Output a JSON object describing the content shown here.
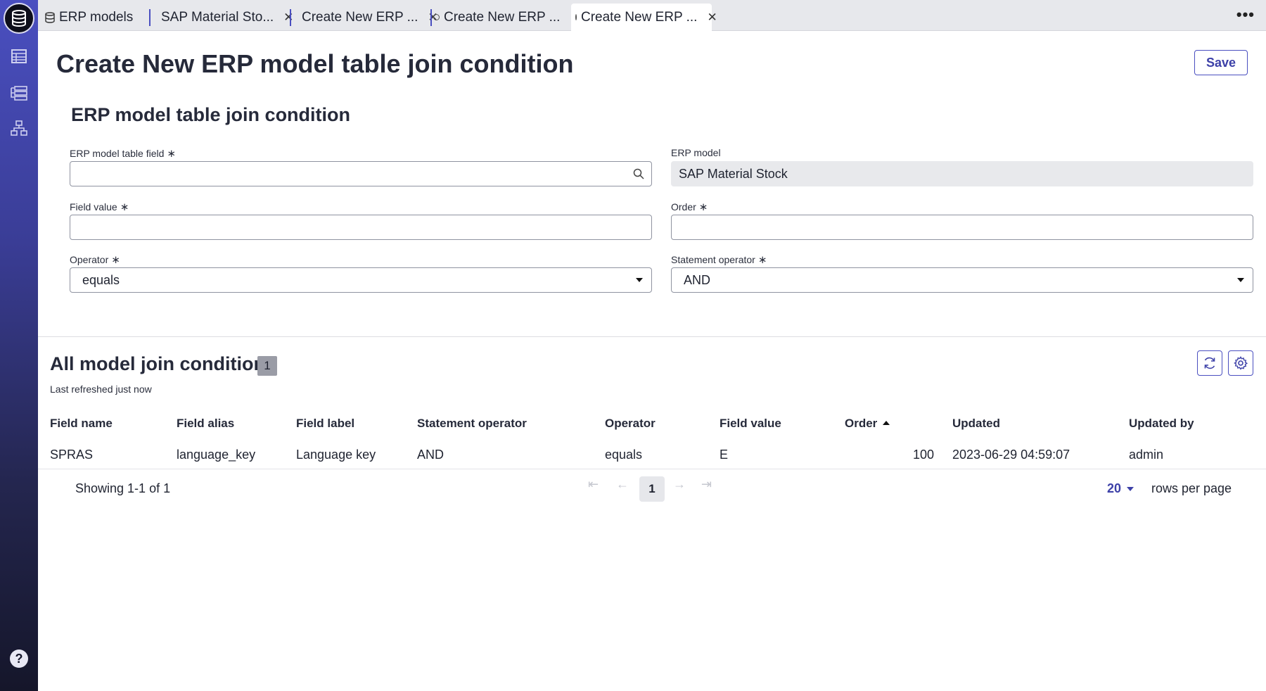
{
  "tabs": [
    {
      "label": "ERP models",
      "closable": false
    },
    {
      "label": "SAP Material Sto...",
      "closable": true
    },
    {
      "label": "Create New ERP ...",
      "closable": true
    },
    {
      "label": "Create New ERP ...",
      "closable": true
    },
    {
      "label": "Create New ERP ...",
      "closable": true,
      "active": true
    }
  ],
  "more_label": "•••",
  "page": {
    "title": "Create New ERP model table join condition",
    "save_label": "Save"
  },
  "form": {
    "section_title": "ERP model table join condition",
    "required_mark": "∗",
    "table_field": {
      "label": "ERP model table field",
      "value": ""
    },
    "erp_model": {
      "label": "ERP model",
      "value": "SAP Material Stock"
    },
    "field_value": {
      "label": "Field value",
      "value": ""
    },
    "order": {
      "label": "Order",
      "value": ""
    },
    "operator": {
      "label": "Operator",
      "value": "equals"
    },
    "statement_operator": {
      "label": "Statement operator",
      "value": "AND"
    }
  },
  "list": {
    "title": "All model join conditions",
    "count": "1",
    "refreshed": "Last refreshed just now",
    "columns": [
      "Field name",
      "Field alias",
      "Field label",
      "Statement operator",
      "Operator",
      "Field value",
      "Order",
      "Updated",
      "Updated by"
    ],
    "rows": [
      [
        "SPRAS",
        "language_key",
        "Language key",
        "AND",
        "equals",
        "E",
        "100",
        "2023-06-29 04:59:07",
        "admin"
      ]
    ],
    "showing": "Showing 1-1 of 1",
    "current_page": "1",
    "rows_per_page_value": "20",
    "rows_per_page_label": "rows per page"
  },
  "help_label": "?",
  "colors": {
    "accent": "#4a4fc0",
    "sidebar_dark": "#15162a"
  }
}
